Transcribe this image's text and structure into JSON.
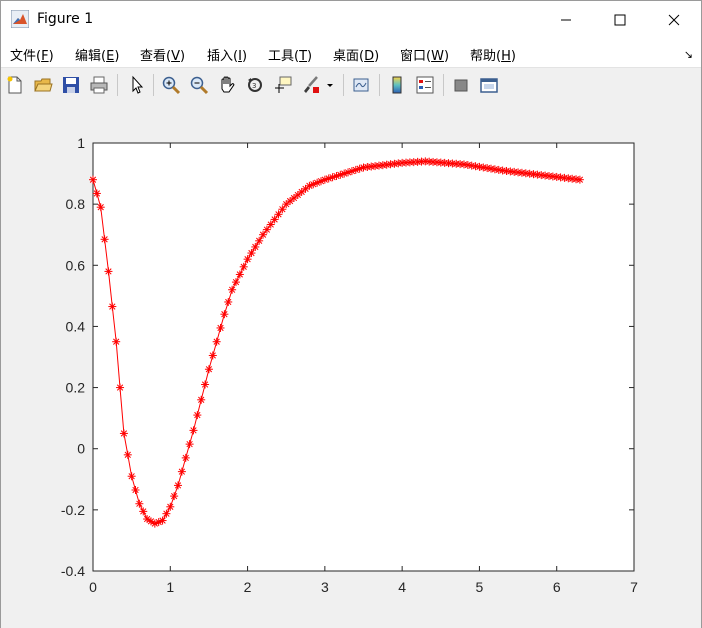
{
  "window": {
    "title": "Figure 1"
  },
  "menu": {
    "items": [
      {
        "label": "文件",
        "key": "F"
      },
      {
        "label": "编辑",
        "key": "E"
      },
      {
        "label": "查看",
        "key": "V"
      },
      {
        "label": "插入",
        "key": "I"
      },
      {
        "label": "工具",
        "key": "T"
      },
      {
        "label": "桌面",
        "key": "D"
      },
      {
        "label": "窗口",
        "key": "W"
      },
      {
        "label": "帮助",
        "key": "H"
      }
    ]
  },
  "toolbar": {
    "icons": [
      "new-figure-icon",
      "open-file-icon",
      "save-icon",
      "print-icon",
      "select-arrow-icon",
      "zoom-in-icon",
      "zoom-out-icon",
      "pan-hand-icon",
      "rotate-3d-icon",
      "data-cursor-icon",
      "brush-icon",
      "link-plot-icon",
      "insert-colorbar-icon",
      "insert-legend-icon",
      "hide-plot-tools-icon",
      "show-plot-tools-icon"
    ]
  },
  "chart_data": {
    "type": "line",
    "title": "",
    "xlabel": "",
    "ylabel": "",
    "xlim": [
      0,
      7
    ],
    "ylim": [
      -0.4,
      1
    ],
    "xticks": [
      "0",
      "1",
      "2",
      "3",
      "4",
      "5",
      "6",
      "7"
    ],
    "yticks": [
      "1",
      "0.8",
      "0.6",
      "0.4",
      "0.2",
      "0",
      "-0.2",
      "-0.4"
    ],
    "grid": false,
    "color": "#ff0000",
    "marker": "asterisk",
    "x_range": [
      0,
      6.3
    ],
    "anchors": [
      [
        0,
        0.88
      ],
      [
        0.1,
        0.79
      ],
      [
        0.2,
        0.58
      ],
      [
        0.3,
        0.35
      ],
      [
        0.4,
        0.05
      ],
      [
        0.5,
        -0.09
      ],
      [
        0.6,
        -0.18
      ],
      [
        0.7,
        -0.23
      ],
      [
        0.8,
        -0.245
      ],
      [
        0.9,
        -0.235
      ],
      [
        1.0,
        -0.19
      ],
      [
        1.1,
        -0.12
      ],
      [
        1.2,
        -0.03
      ],
      [
        1.3,
        0.06
      ],
      [
        1.4,
        0.16
      ],
      [
        1.5,
        0.26
      ],
      [
        1.6,
        0.35
      ],
      [
        1.7,
        0.44
      ],
      [
        1.8,
        0.52
      ],
      [
        2.0,
        0.62
      ],
      [
        2.2,
        0.7
      ],
      [
        2.5,
        0.8
      ],
      [
        2.8,
        0.86
      ],
      [
        3.0,
        0.88
      ],
      [
        3.5,
        0.92
      ],
      [
        4.0,
        0.935
      ],
      [
        4.3,
        0.94
      ],
      [
        4.8,
        0.93
      ],
      [
        5.3,
        0.91
      ],
      [
        5.8,
        0.895
      ],
      [
        6.3,
        0.88
      ]
    ]
  }
}
